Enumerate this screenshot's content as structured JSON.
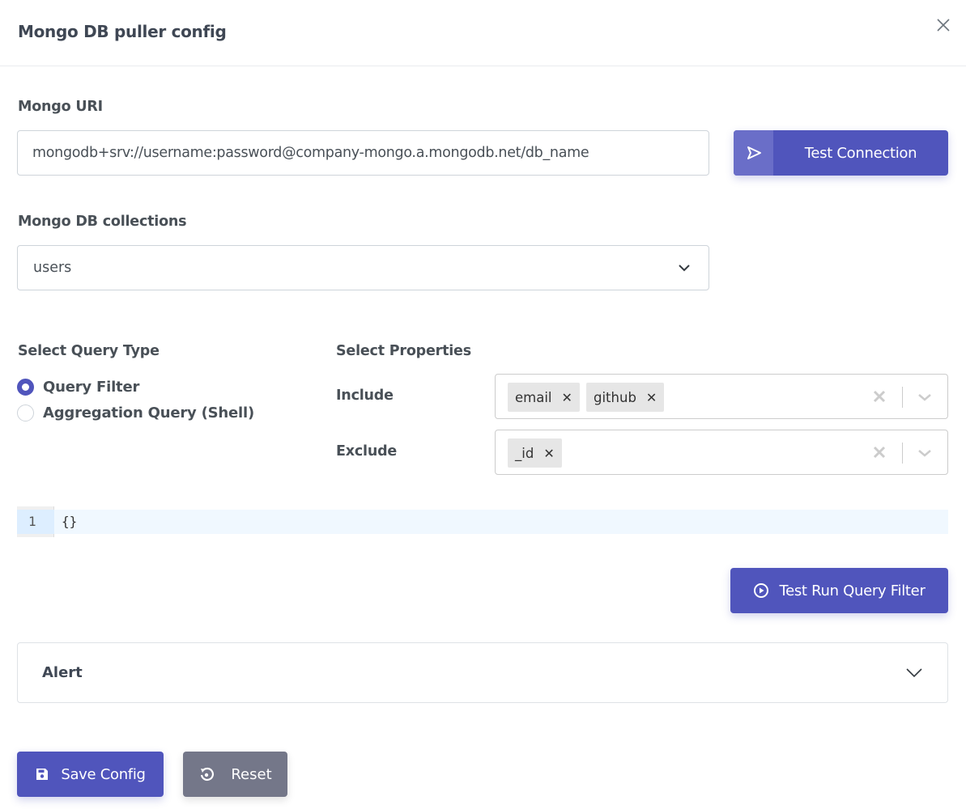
{
  "dialog": {
    "title": "Mongo DB puller config",
    "close_icon": "close-icon"
  },
  "uri": {
    "label": "Mongo URI",
    "value": "mongodb+srv://username:password@company-mongo.a.mongodb.net/db_name",
    "test_button_label": "Test Connection",
    "test_button_icon": "send-icon"
  },
  "collections": {
    "label": "Mongo DB collections",
    "selected": "users"
  },
  "query_type": {
    "label": "Select Query Type",
    "options": [
      {
        "label": "Query Filter",
        "checked": true
      },
      {
        "label": "Aggregation Query (Shell)",
        "checked": false
      }
    ]
  },
  "properties": {
    "label": "Select Properties",
    "include": {
      "label": "Include",
      "values": [
        "email",
        "github"
      ]
    },
    "exclude": {
      "label": "Exclude",
      "values": [
        "_id"
      ]
    }
  },
  "editor": {
    "lines": [
      {
        "number": "1",
        "text": "{}"
      }
    ]
  },
  "run_button": {
    "label": "Test Run Query Filter",
    "icon": "play-circle-icon"
  },
  "alert": {
    "label": "Alert"
  },
  "footer": {
    "save_label": "Save Config",
    "reset_label": "Reset"
  },
  "colors": {
    "primary": "#5055bc",
    "secondary": "#747789",
    "editor_bg": "#f0f8ff"
  }
}
